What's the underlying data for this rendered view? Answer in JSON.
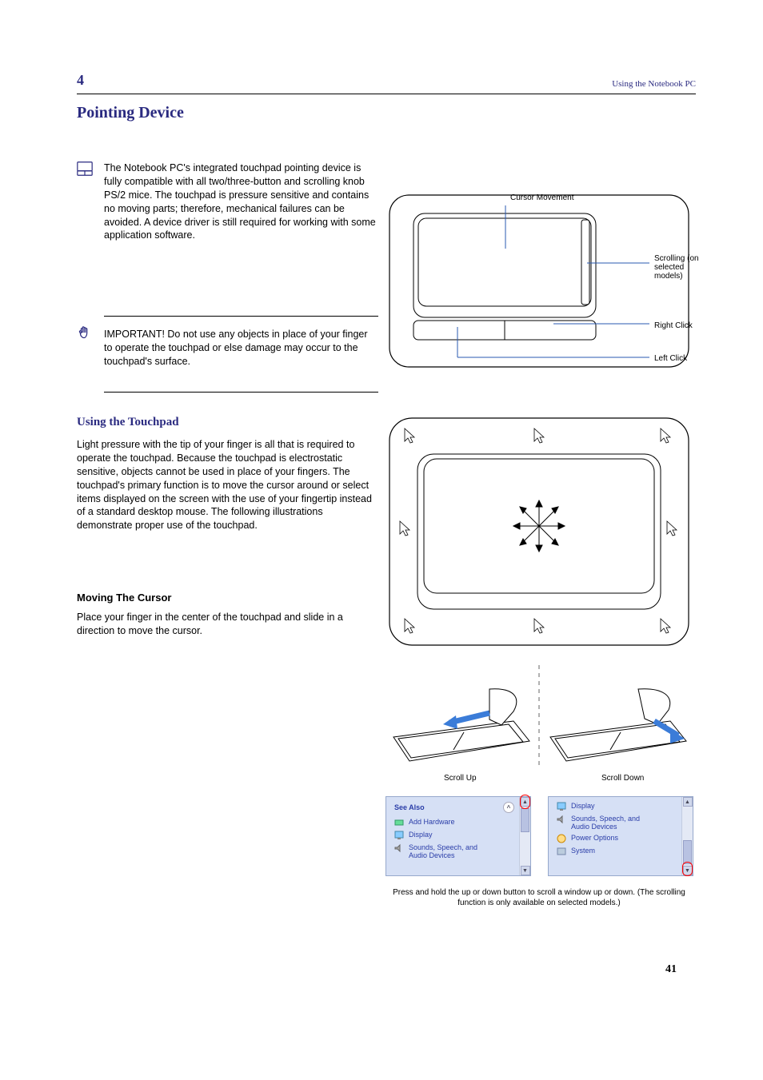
{
  "header": {
    "left": "4",
    "right": "Using the Notebook PC"
  },
  "page_num": "41",
  "section_title": "Pointing Device",
  "intro": "The Notebook PC's integrated touchpad pointing device is fully compatible with all two/three-button and scrolling knob PS/2 mice. The touchpad is pressure sensitive and contains no moving parts; therefore, mechanical failures can be avoided. A device driver is still required for working with some application software.",
  "important": "IMPORTANT! Do not use any objects in place of your finger to operate the touchpad or else damage may occur to the touchpad's surface.",
  "touchpad_labels": {
    "cursor": "Cursor Movement",
    "scroll": "Scrolling (on selected models)",
    "right": "Right Click",
    "left": "Left Click"
  },
  "using_title": "Using the Touchpad",
  "using_text": "Light pressure with the tip of your finger is all that is required to operate the touchpad. Because the touchpad is electrostatic sensitive, objects cannot be used in place of your fingers. The touchpad's primary function is to move the cursor around or select items displayed on the screen with the use of your fingertip instead of a standard desktop mouse. The following illustrations demonstrate proper use of the touchpad.",
  "moving_title": "Moving The Cursor",
  "moving_text": "Place your finger in the center of the touchpad and slide in a direction to move the cursor.",
  "scroll_up": "Scroll Up",
  "scroll_down": "Scroll Down",
  "scroll_caption": "Press and hold the up or down button to scroll a window up or down. (The scrolling function is only available on selected models.)",
  "pane_left": {
    "title": "See Also",
    "items": [
      "Add Hardware",
      "Display",
      "Sounds, Speech, and Audio Devices"
    ]
  },
  "pane_right": {
    "items": [
      "Display",
      "Sounds, Speech, and Audio Devices",
      "Power Options",
      "System"
    ]
  }
}
